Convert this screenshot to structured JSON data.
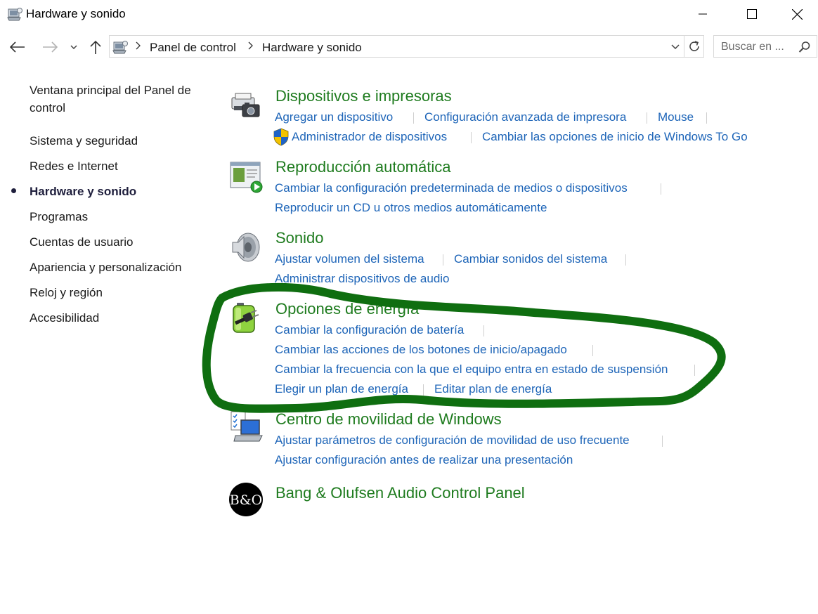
{
  "window": {
    "title": "Hardware y sonido",
    "icons": [
      "control-panel-icon",
      "minimize-icon",
      "maximize-icon",
      "close-icon"
    ]
  },
  "nav": {
    "breadcrumb": [
      "Panel de control",
      "Hardware y sonido"
    ],
    "search_placeholder": "Buscar en ..."
  },
  "sidebar": {
    "home_label": "Ventana principal del Panel de control",
    "items": [
      {
        "label": "Sistema y seguridad"
      },
      {
        "label": "Redes e Internet"
      },
      {
        "label": "Hardware y sonido",
        "active": true
      },
      {
        "label": "Programas"
      },
      {
        "label": "Cuentas de usuario"
      },
      {
        "label": "Apariencia y personalización"
      },
      {
        "label": "Reloj y región"
      },
      {
        "label": "Accesibilidad"
      }
    ]
  },
  "categories": [
    {
      "title": "Dispositivos e impresoras",
      "icon": "printer-camera-icon",
      "links": [
        "Agregar un dispositivo",
        "Configuración avanzada de impresora",
        "Mouse",
        "Administrador de dispositivos",
        "Cambiar las opciones de inicio de Windows To Go"
      ]
    },
    {
      "title": "Reproducción automática",
      "icon": "autoplay-icon",
      "links": [
        "Cambiar la configuración predeterminada de medios o dispositivos",
        "Reproducir un CD u otros medios automáticamente"
      ]
    },
    {
      "title": "Sonido",
      "icon": "speaker-icon",
      "links": [
        "Ajustar volumen del sistema",
        "Cambiar sonidos del sistema",
        "Administrar dispositivos de audio"
      ]
    },
    {
      "title": "Opciones de energía",
      "icon": "battery-plug-icon",
      "links": [
        "Cambiar la configuración de batería",
        "Cambiar las acciones de los botones de inicio/apagado",
        "Cambiar la frecuencia con la que el equipo entra en estado de suspensión",
        "Elegir un plan de energía",
        "Editar plan de energía"
      ]
    },
    {
      "title": "Centro de movilidad de Windows",
      "icon": "mobility-laptop-icon",
      "links": [
        "Ajustar parámetros de configuración de movilidad de uso frecuente",
        "Ajustar configuración antes de realizar una presentación"
      ]
    },
    {
      "title": "Bang & Olufsen Audio Control Panel",
      "icon": "bang-olufsen-logo-icon",
      "links": []
    }
  ],
  "bo_logo_text": "B&O",
  "colors": {
    "category_title": "#1e7b1e",
    "link": "#1e65b8",
    "annotation_stroke": "#0f6e10",
    "active_nav": "#1e1e3c"
  }
}
